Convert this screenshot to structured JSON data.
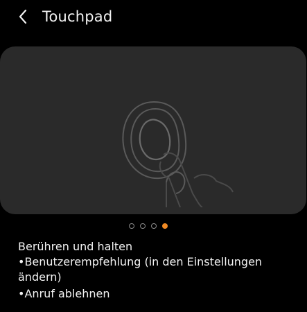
{
  "header": {
    "title": "Touchpad",
    "back_icon": "chevron-left-icon"
  },
  "illustration": {
    "icon": "earbud-touch-icon"
  },
  "pager": {
    "total": 4,
    "active_index": 3,
    "active_color": "#f08a24"
  },
  "description": {
    "heading": "Berühren und halten",
    "items": [
      {
        "line1": "•Benutzerempfehlung (in den Einstellungen",
        "line2": "ändern)"
      },
      {
        "line1": "•Anruf ablehnen"
      }
    ]
  }
}
